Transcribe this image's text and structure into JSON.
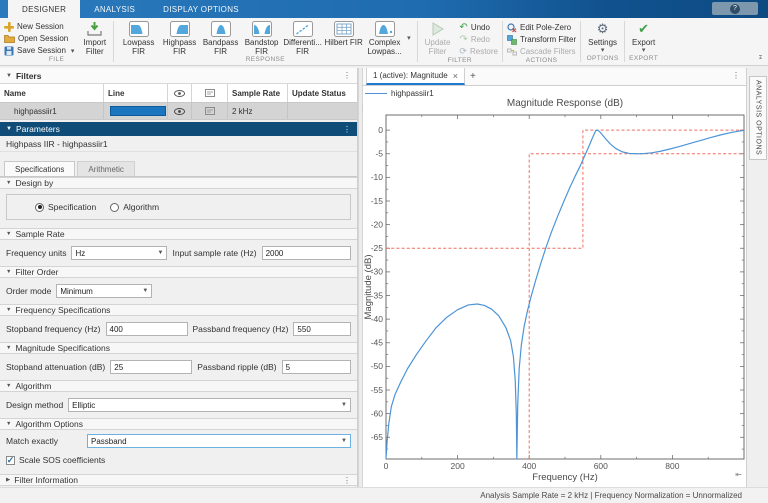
{
  "app": {
    "menu_tabs": [
      "DESIGNER",
      "ANALYSIS",
      "DISPLAY OPTIONS"
    ],
    "help": "?",
    "status_bar": "Analysis Sample Rate = 2 kHz | Frequency Normalization = Unnormalized"
  },
  "ribbon": {
    "file": {
      "group": "FILE",
      "new": "New Session",
      "open": "Open Session",
      "save": "Save Session",
      "import1": "Import",
      "import2": "Filter"
    },
    "response": {
      "group": "RESPONSE",
      "buttons": [
        {
          "l1": "Lowpass",
          "l2": "FIR"
        },
        {
          "l1": "Highpass",
          "l2": "FIR"
        },
        {
          "l1": "Bandpass",
          "l2": "FIR"
        },
        {
          "l1": "Bandstop",
          "l2": "FIR"
        },
        {
          "l1": "Differenti...",
          "l2": "FIR"
        },
        {
          "l1": "Hilbert FIR",
          "l2": ""
        },
        {
          "l1": "Complex",
          "l2": "Lowpas..."
        }
      ]
    },
    "filter": {
      "group": "FILTER",
      "update1": "Update",
      "update2": "Filter",
      "undo": "Undo",
      "redo": "Redo",
      "restore": "Restore"
    },
    "actions": {
      "group": "ACTIONS",
      "edit": "Edit Pole-Zero",
      "transform": "Transform Filter",
      "cascade": "Cascade Filters"
    },
    "options": {
      "group": "OPTIONS",
      "settings": "Settings"
    },
    "export": {
      "group": "EXPORT",
      "export": "Export"
    }
  },
  "filters_panel": {
    "title": "Filters",
    "columns": {
      "name": "Name",
      "line": "Line",
      "sample_rate": "Sample Rate",
      "update_status": "Update Status"
    },
    "row": {
      "name": "highpassiir1",
      "sample_rate": "2 kHz",
      "update_status": "",
      "line_color": "#1b75bf"
    }
  },
  "params": {
    "title": "Parameters",
    "subtitle": "Highpass IIR - highpassiir1",
    "tabs": [
      "Specifications",
      "Arithmetic"
    ],
    "design_by": {
      "header": "Design by",
      "radio_spec": "Specification",
      "radio_algo": "Algorithm"
    },
    "sample_rate": {
      "header": "Sample Rate",
      "units_label": "Frequency units",
      "units_value": "Hz",
      "rate_label": "Input sample rate (Hz)",
      "rate_value": "2000"
    },
    "filter_order": {
      "header": "Filter Order",
      "mode_label": "Order mode",
      "mode_value": "Minimum"
    },
    "freq_specs": {
      "header": "Frequency Specifications",
      "stop_label": "Stopband frequency (Hz)",
      "stop_value": "400",
      "pass_label": "Passband frequency (Hz)",
      "pass_value": "550"
    },
    "mag_specs": {
      "header": "Magnitude Specifications",
      "atten_label": "Stopband attenuation (dB)",
      "atten_value": "25",
      "ripple_label": "Passband ripple (dB)",
      "ripple_value": "5"
    },
    "algorithm": {
      "header": "Algorithm",
      "method_label": "Design method",
      "method_value": "Elliptic"
    },
    "algo_options": {
      "header": "Algorithm Options",
      "match_label": "Match exactly",
      "match_value": "Passband",
      "scale_label": "Scale SOS coefficients"
    },
    "filter_info": {
      "header": "Filter Information"
    }
  },
  "plot": {
    "tab_label": "1 (active): Magnitude",
    "close": "×",
    "new_tab": "+",
    "legend": "highpassiir1",
    "side_panel": "ANALYSIS OPTIONS"
  },
  "chart_data": {
    "type": "line",
    "title": "Magnitude Response (dB)",
    "xlabel": "Frequency (Hz)",
    "ylabel": "Magnitude (dB)",
    "xlim": [
      0,
      1000
    ],
    "ylim": [
      -69.6,
      3.2
    ],
    "xticks": [
      0,
      200,
      400,
      600,
      800
    ],
    "xminor": [
      100,
      300,
      500,
      700,
      900
    ],
    "yticks": [
      0,
      -5,
      -10,
      -15,
      -20,
      -25,
      -30,
      -35,
      -40,
      -45,
      -50,
      -55,
      -60,
      -65
    ],
    "grid": false,
    "legend_position": "top-left-outside",
    "line_color": "#4d94d6",
    "mask_color": "#ef6f63",
    "axis_color": "#6e6e6e",
    "series": [
      {
        "name": "highpassiir1",
        "points": [
          [
            0,
            -69.6
          ],
          [
            3,
            -66
          ],
          [
            8,
            -62
          ],
          [
            15,
            -58.5
          ],
          [
            25,
            -56
          ],
          [
            40,
            -53.5
          ],
          [
            60,
            -50.5
          ],
          [
            85,
            -47.5
          ],
          [
            110,
            -44.8
          ],
          [
            140,
            -41.8
          ],
          [
            170,
            -39.6
          ],
          [
            200,
            -38
          ],
          [
            230,
            -37
          ],
          [
            255,
            -36.8
          ],
          [
            275,
            -37.1
          ],
          [
            295,
            -37.9
          ],
          [
            315,
            -39.3
          ],
          [
            335,
            -41.8
          ],
          [
            348,
            -44.5
          ],
          [
            356,
            -48
          ],
          [
            361,
            -53
          ],
          [
            364,
            -60
          ],
          [
            365.5,
            -69.6
          ],
          [
            368,
            -58
          ],
          [
            372,
            -50.5
          ],
          [
            378,
            -45.5
          ],
          [
            386,
            -41.5
          ],
          [
            395,
            -38.3
          ],
          [
            405,
            -35.3
          ],
          [
            418,
            -31.8
          ],
          [
            432,
            -28.3
          ],
          [
            447,
            -24.8
          ],
          [
            462,
            -21.6
          ],
          [
            478,
            -18.5
          ],
          [
            495,
            -15.4
          ],
          [
            512,
            -12.4
          ],
          [
            528,
            -9.8
          ],
          [
            543,
            -7.5
          ],
          [
            557,
            -5.1
          ],
          [
            568,
            -3.2
          ],
          [
            578,
            -1.4
          ],
          [
            586,
            -0.1
          ],
          [
            592,
            0
          ],
          [
            600,
            -0.6
          ],
          [
            612,
            -1.7
          ],
          [
            626,
            -2.9
          ],
          [
            642,
            -3.9
          ],
          [
            660,
            -4.6
          ],
          [
            680,
            -4.93
          ],
          [
            700,
            -5
          ],
          [
            720,
            -4.97
          ],
          [
            742,
            -4.8
          ],
          [
            765,
            -4.5
          ],
          [
            790,
            -4.05
          ],
          [
            818,
            -3.5
          ],
          [
            848,
            -2.85
          ],
          [
            878,
            -2.2
          ],
          [
            908,
            -1.55
          ],
          [
            938,
            -0.95
          ],
          [
            962,
            -0.55
          ],
          [
            982,
            -0.25
          ],
          [
            1000,
            -0.05
          ]
        ]
      }
    ],
    "mask_segments": [
      [
        [
          0,
          -25
        ],
        [
          550,
          -25
        ],
        [
          550,
          0
        ],
        [
          1000,
          0
        ]
      ],
      [
        [
          400,
          -69.6
        ],
        [
          400,
          -5
        ],
        [
          1000,
          -5
        ]
      ]
    ]
  }
}
